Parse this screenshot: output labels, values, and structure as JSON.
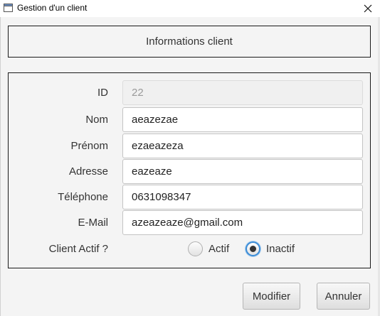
{
  "window": {
    "title": "Gestion d'un client",
    "close_glyph": "✕"
  },
  "header": {
    "title": "Informations client"
  },
  "form": {
    "id": {
      "label": "ID",
      "value": "22"
    },
    "nom": {
      "label": "Nom",
      "value": "aeazezae"
    },
    "prenom": {
      "label": "Prénom",
      "value": "ezaeazeza"
    },
    "adresse": {
      "label": "Adresse",
      "value": "eazeaze"
    },
    "telephone": {
      "label": "Téléphone",
      "value": "0631098347"
    },
    "email": {
      "label": "E-Mail",
      "value": "azeazeaze@gmail.com"
    },
    "actif": {
      "label": "Client Actif ?",
      "options": [
        "Actif",
        "Inactif"
      ],
      "selected": "Inactif"
    }
  },
  "buttons": {
    "modifier": "Modifier",
    "annuler": "Annuler"
  },
  "icons": {
    "app": "window-icon",
    "close": "close-icon"
  },
  "colors": {
    "focus_accent": "#3a8bd6",
    "panel_border": "#1a1a1a"
  }
}
